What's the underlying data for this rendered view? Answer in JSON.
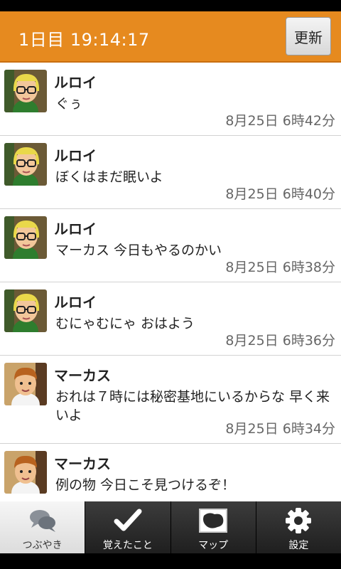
{
  "header": {
    "title": "1日目 19:14:17",
    "refresh_label": "更新"
  },
  "posts": [
    {
      "name": "ルロイ",
      "message": "ぐぅ",
      "time": "8月25日 6時42分",
      "avatar": "leroy"
    },
    {
      "name": "ルロイ",
      "message": "ぼくはまだ眠いよ",
      "time": "8月25日 6時40分",
      "avatar": "leroy"
    },
    {
      "name": "ルロイ",
      "message": "マーカス 今日もやるのかい",
      "time": "8月25日 6時38分",
      "avatar": "leroy"
    },
    {
      "name": "ルロイ",
      "message": "むにゃむにゃ おはよう",
      "time": "8月25日 6時36分",
      "avatar": "leroy"
    },
    {
      "name": "マーカス",
      "message": "おれは７時には秘密基地にいるからな 早く来いよ",
      "time": "8月25日 6時34分",
      "avatar": "marcus"
    },
    {
      "name": "マーカス",
      "message": "例の物 今日こそ見つけるぞ！",
      "time": "",
      "avatar": "marcus"
    }
  ],
  "tabs": [
    {
      "label": "つぶやき",
      "icon": "speech-bubbles-icon",
      "active": true
    },
    {
      "label": "覚えたこと",
      "icon": "checkmark-icon",
      "active": false
    },
    {
      "label": "マップ",
      "icon": "map-icon",
      "active": false
    },
    {
      "label": "設定",
      "icon": "gear-icon",
      "active": false
    }
  ],
  "colors": {
    "header": "#e68a1f",
    "tabbar": "#2a2a2a",
    "active_tab": "#e8e8e8"
  }
}
